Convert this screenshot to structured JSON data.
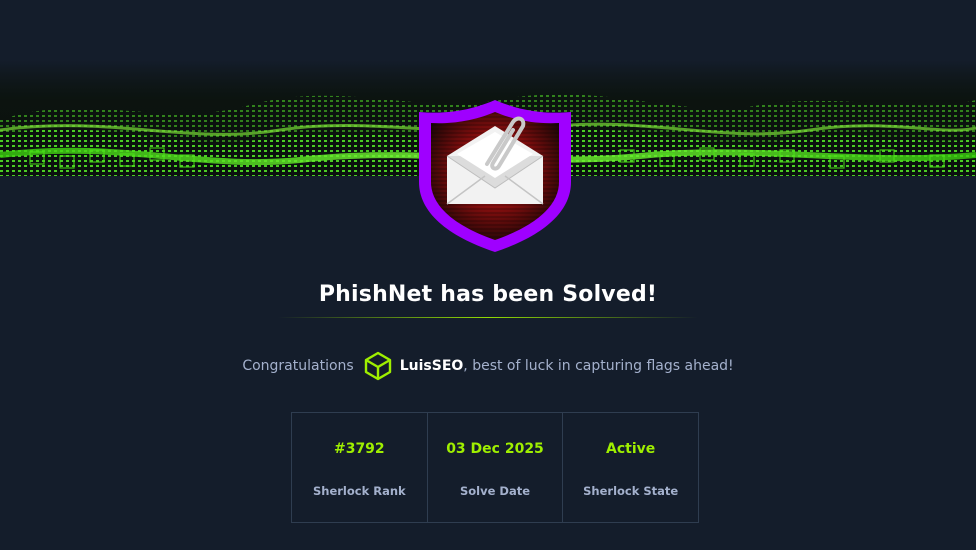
{
  "header": {
    "title": "PhishNet has been Solved!"
  },
  "congrats": {
    "prefix": "Congratulations",
    "username": "LuisSEO",
    "suffix": ", best of luck in capturing flags ahead!"
  },
  "stats": [
    {
      "value": "#3792",
      "label": "Sherlock Rank"
    },
    {
      "value": "03 Dec 2025",
      "label": "Solve Date"
    },
    {
      "value": "Active",
      "label": "Sherlock State"
    }
  ],
  "colors": {
    "background": "#141d2b",
    "accent": "#9fef00",
    "badge_border": "#9f00ff",
    "muted_text": "#a4b1cd"
  },
  "icons": {
    "badge": "envelope-paperclip-shield-icon",
    "user": "cube-icon"
  }
}
